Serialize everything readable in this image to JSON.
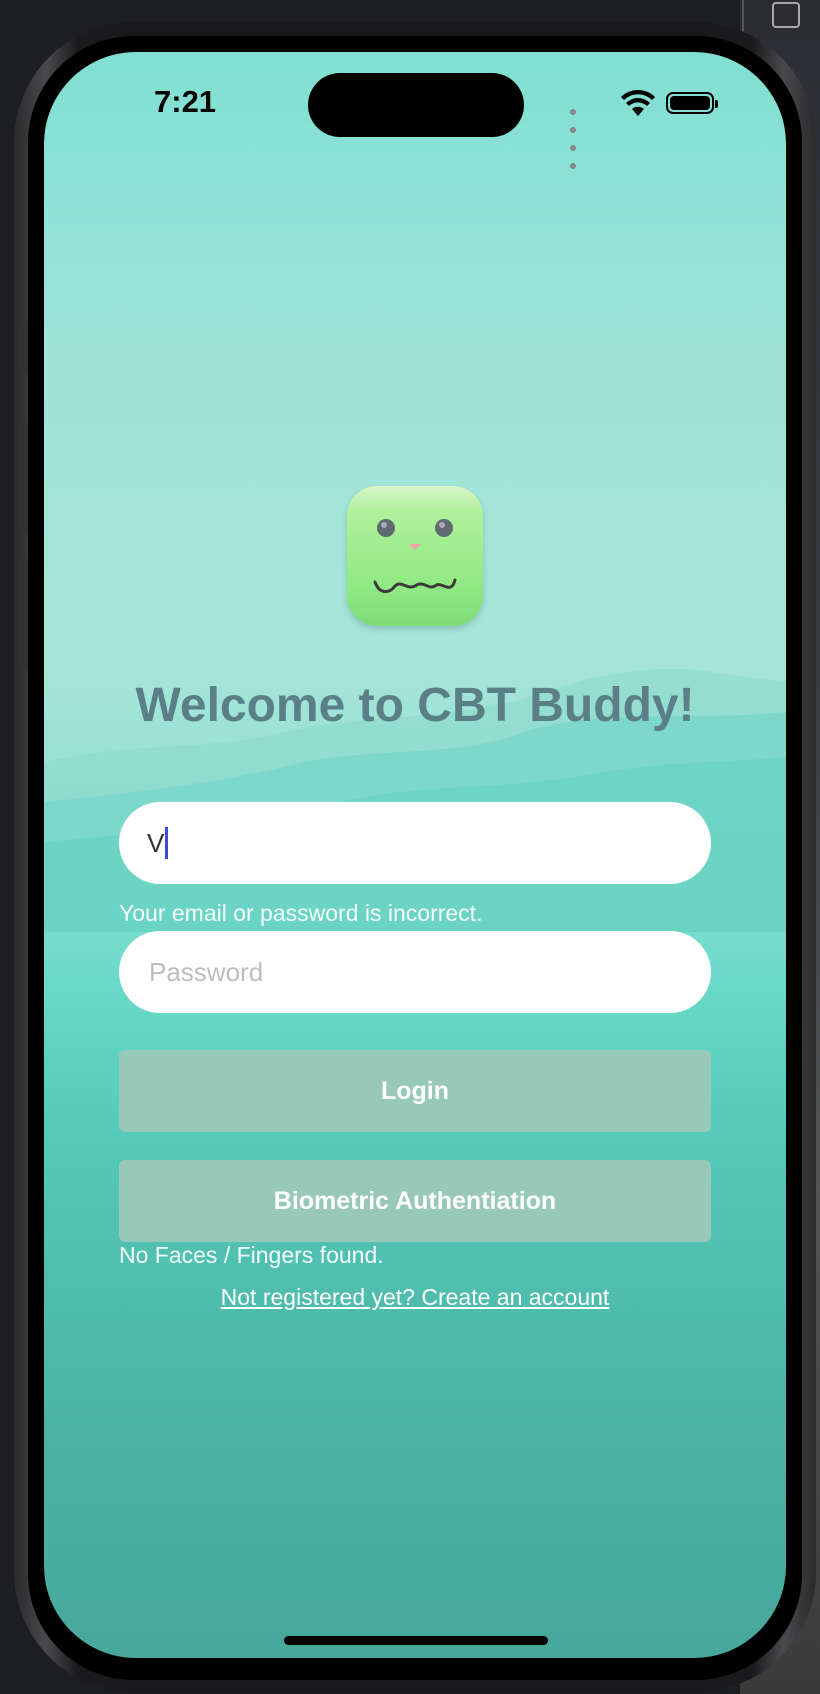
{
  "status_bar": {
    "time": "7:21"
  },
  "title": "Welcome to CBT Buddy!",
  "email": {
    "value": "V",
    "placeholder": ""
  },
  "error_message": "Your email or password is incorrect.",
  "password": {
    "placeholder": "Password"
  },
  "login_button": "Login",
  "biometric_button": "Biometric Authentiation",
  "biometric_message": "No Faces / Fingers found.",
  "register_link": "Not registered yet? Create an account",
  "colors": {
    "title": "#5a7f86",
    "button": "#98c8b8",
    "logo": "#92ea84"
  },
  "icons": [
    "app-logo-icon",
    "wifi-icon",
    "battery-icon",
    "signal-dots-icon"
  ]
}
